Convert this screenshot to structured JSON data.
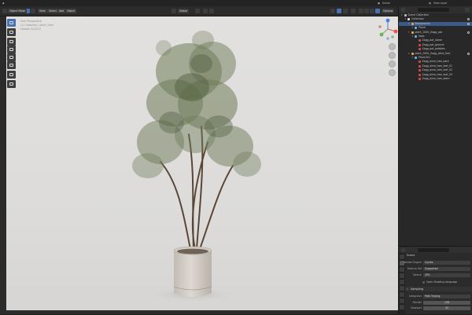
{
  "topbar": {
    "scene_label": "Scene",
    "view_layer_label": "View Layer"
  },
  "viewport_header": {
    "mode_label": "Object Mode",
    "menus": [
      "View",
      "Select",
      "Add",
      "Object"
    ],
    "transform_label": "Global",
    "options_label": "Options"
  },
  "viewport_overlay": {
    "lines": [
      "User Perspective",
      "(1) Collection | plant_Olive",
      "Sample 512/512"
    ]
  },
  "outliner": {
    "search_placeholder": "",
    "items": [
      {
        "label": "Scene Collection",
        "depth": 0,
        "kind": "scene",
        "selected": false,
        "eye": false
      },
      {
        "label": "Collection",
        "depth": 1,
        "kind": "collection",
        "selected": false,
        "eye": true
      },
      {
        "label": "Background",
        "depth": 2,
        "kind": "object",
        "selected": true,
        "eye": true
      },
      {
        "label": "Plane",
        "depth": 3,
        "kind": "mesh",
        "selected": false,
        "eye": false
      },
      {
        "label": "plant_1000_Zagg_pot",
        "depth": 2,
        "kind": "object",
        "selected": false,
        "eye": true
      },
      {
        "label": "Vase",
        "depth": 3,
        "kind": "mesh",
        "selected": false,
        "eye": false
      },
      {
        "label": "Zagg_pot_stone",
        "depth": 4,
        "kind": "material",
        "selected": false,
        "eye": false
      },
      {
        "label": "Zagg_pot_ground",
        "depth": 4,
        "kind": "material",
        "selected": false,
        "eye": false
      },
      {
        "label": "Zagg_pot_pebbles",
        "depth": 4,
        "kind": "material",
        "selected": false,
        "eye": false
      },
      {
        "label": "plant_1000_Zagg_olive_tree",
        "depth": 2,
        "kind": "object",
        "selected": false,
        "eye": true
      },
      {
        "label": "Plant.001",
        "depth": 3,
        "kind": "mesh",
        "selected": false,
        "eye": false
      },
      {
        "label": "Zagg_olive_tree_bark",
        "depth": 4,
        "kind": "material",
        "selected": false,
        "eye": false
      },
      {
        "label": "Zagg_olive_tree_leaf_01",
        "depth": 4,
        "kind": "material",
        "selected": false,
        "eye": false
      },
      {
        "label": "Zagg_olive_tree_leaf_02",
        "depth": 4,
        "kind": "material",
        "selected": false,
        "eye": false
      },
      {
        "label": "Zagg_olive_tree_leaf_03",
        "depth": 4,
        "kind": "material",
        "selected": false,
        "eye": false
      },
      {
        "label": "Zagg_olive_tree_stem",
        "depth": 4,
        "kind": "material",
        "selected": false,
        "eye": false
      }
    ]
  },
  "properties": {
    "context_label": "Scene",
    "rows": [
      {
        "label": "Render Engine",
        "value": "Cycles",
        "numeric": false
      },
      {
        "label": "Feature Set",
        "value": "Supported",
        "numeric": false
      },
      {
        "label": "Device",
        "value": "CPU",
        "numeric": false
      }
    ],
    "osl_label": "Open Shading Language",
    "sampling_label": "Sampling",
    "integrator_label": "Integrator",
    "integrator_value": "Path Tracing",
    "render_label": "Render",
    "render_value": "128",
    "viewport_label": "Viewport",
    "viewport_value": "32"
  },
  "colors": {
    "accent": "#4772b3",
    "selected_row": "#3b5a8a",
    "viewport_bg": "#dcdbd9",
    "leaf": "#6f7c5a",
    "trunk": "#5a4636",
    "pot": "#cfcac4"
  }
}
